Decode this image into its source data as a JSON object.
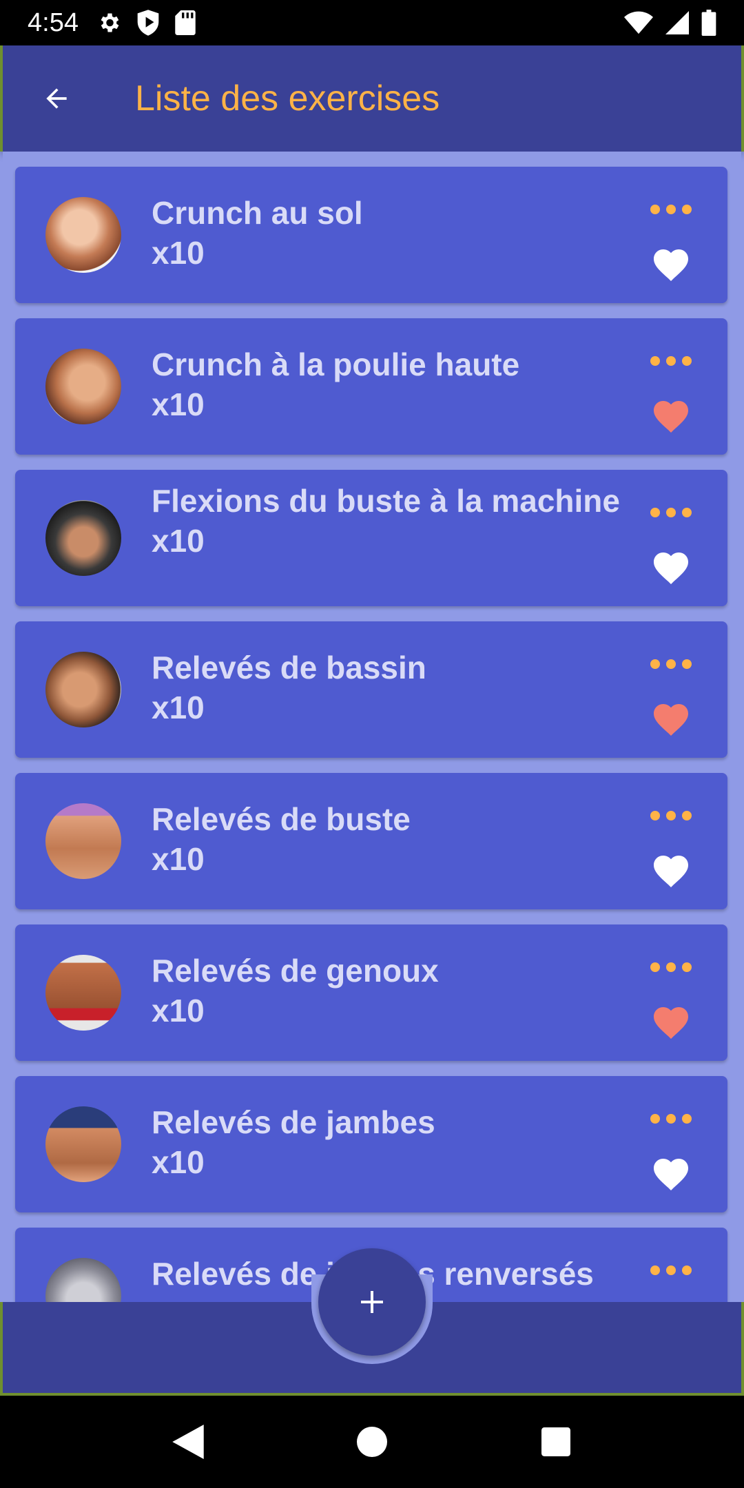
{
  "status_bar": {
    "time": "4:54",
    "icons_left": [
      "gear-icon",
      "shield-play-icon",
      "sd-card-icon"
    ],
    "icons_right": [
      "wifi-icon",
      "cell-signal-icon",
      "battery-icon"
    ]
  },
  "app_bar": {
    "title": "Liste des exercises",
    "title_color": "#ffb347",
    "background": "#3a4196"
  },
  "exercises": [
    {
      "name": "Crunch au sol",
      "reps": "x10",
      "favorite": false
    },
    {
      "name": "Crunch à la poulie haute",
      "reps": "x10",
      "favorite": true
    },
    {
      "name": "Flexions du buste à la machine",
      "reps": "x10",
      "favorite": false
    },
    {
      "name": "Relevés de bassin",
      "reps": "x10",
      "favorite": true
    },
    {
      "name": "Relevés de buste",
      "reps": "x10",
      "favorite": false
    },
    {
      "name": "Relevés de genoux",
      "reps": "x10",
      "favorite": true
    },
    {
      "name": "Relevés de jambes",
      "reps": "x10",
      "favorite": false
    },
    {
      "name": "Relevés de jambes renversés",
      "reps": "",
      "favorite": false
    }
  ],
  "colors": {
    "card": "#4f5bd0",
    "list_background": "#8f9ae6",
    "accent": "#ffb347",
    "favorite_heart": "#f47d6e",
    "default_heart": "#ffffff"
  },
  "fab": {
    "icon": "plus-icon"
  },
  "nav_bar": {
    "icons": [
      "back-triangle-icon",
      "home-circle-icon",
      "recents-square-icon"
    ]
  }
}
